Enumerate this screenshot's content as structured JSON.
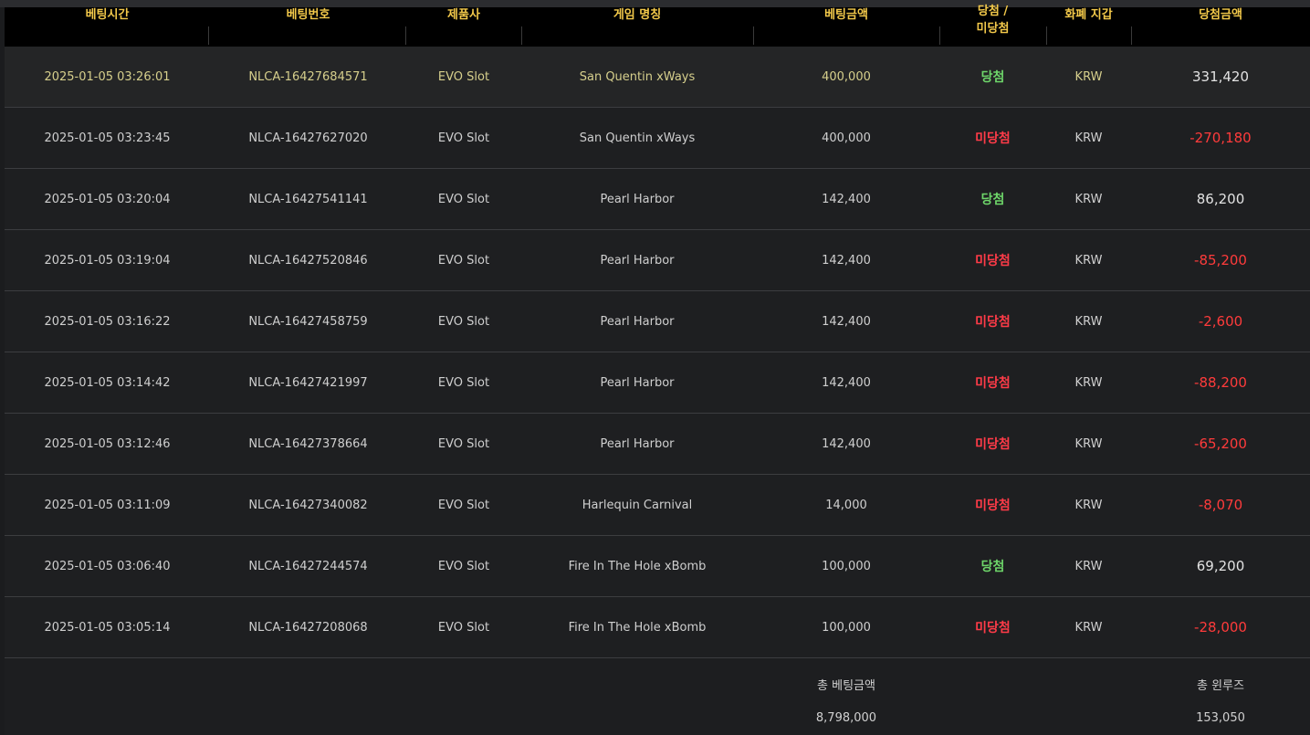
{
  "header": {
    "time": "베팅시간",
    "bet_id": "베팅번호",
    "provider": "제품사",
    "game": "게임 명칭",
    "amount": "베팅금액",
    "result_line1": "당첨 /",
    "result_line2": "미당첨",
    "currency": "화폐 지갑",
    "win_amount": "당첨금액"
  },
  "rows": [
    {
      "time": "2025-01-05 03:26:01",
      "id": "NLCA-16427684571",
      "provider": "EVO Slot",
      "game": "San Quentin xWays",
      "bet": "400,000",
      "result": "당첨",
      "status": "win",
      "currency": "KRW",
      "win": "331,420"
    },
    {
      "time": "2025-01-05 03:23:45",
      "id": "NLCA-16427627020",
      "provider": "EVO Slot",
      "game": "San Quentin xWays",
      "bet": "400,000",
      "result": "미당첨",
      "status": "lose",
      "currency": "KRW",
      "win": "-270,180"
    },
    {
      "time": "2025-01-05 03:20:04",
      "id": "NLCA-16427541141",
      "provider": "EVO Slot",
      "game": "Pearl Harbor",
      "bet": "142,400",
      "result": "당첨",
      "status": "win",
      "currency": "KRW",
      "win": "86,200"
    },
    {
      "time": "2025-01-05 03:19:04",
      "id": "NLCA-16427520846",
      "provider": "EVO Slot",
      "game": "Pearl Harbor",
      "bet": "142,400",
      "result": "미당첨",
      "status": "lose",
      "currency": "KRW",
      "win": "-85,200"
    },
    {
      "time": "2025-01-05 03:16:22",
      "id": "NLCA-16427458759",
      "provider": "EVO Slot",
      "game": "Pearl Harbor",
      "bet": "142,400",
      "result": "미당첨",
      "status": "lose",
      "currency": "KRW",
      "win": "-2,600"
    },
    {
      "time": "2025-01-05 03:14:42",
      "id": "NLCA-16427421997",
      "provider": "EVO Slot",
      "game": "Pearl Harbor",
      "bet": "142,400",
      "result": "미당첨",
      "status": "lose",
      "currency": "KRW",
      "win": "-88,200"
    },
    {
      "time": "2025-01-05 03:12:46",
      "id": "NLCA-16427378664",
      "provider": "EVO Slot",
      "game": "Pearl Harbor",
      "bet": "142,400",
      "result": "미당첨",
      "status": "lose",
      "currency": "KRW",
      "win": "-65,200"
    },
    {
      "time": "2025-01-05 03:11:09",
      "id": "NLCA-16427340082",
      "provider": "EVO Slot",
      "game": "Harlequin Carnival",
      "bet": "14,000",
      "result": "미당첨",
      "status": "lose",
      "currency": "KRW",
      "win": "-8,070"
    },
    {
      "time": "2025-01-05 03:06:40",
      "id": "NLCA-16427244574",
      "provider": "EVO Slot",
      "game": "Fire In The Hole xBomb",
      "bet": "100,000",
      "result": "당첨",
      "status": "win",
      "currency": "KRW",
      "win": "69,200"
    },
    {
      "time": "2025-01-05 03:05:14",
      "id": "NLCA-16427208068",
      "provider": "EVO Slot",
      "game": "Fire In The Hole xBomb",
      "bet": "100,000",
      "result": "미당첨",
      "status": "lose",
      "currency": "KRW",
      "win": "-28,000"
    }
  ],
  "summary": {
    "total_bet_label": "총 베팅금액",
    "total_bet_value": "8,798,000",
    "total_winloss_label": "총 윈루즈",
    "total_winloss_value": "153,050"
  },
  "colors": {
    "header_text": "#f3c94a",
    "win": "#6ed66a",
    "lose": "#ff3b48"
  }
}
